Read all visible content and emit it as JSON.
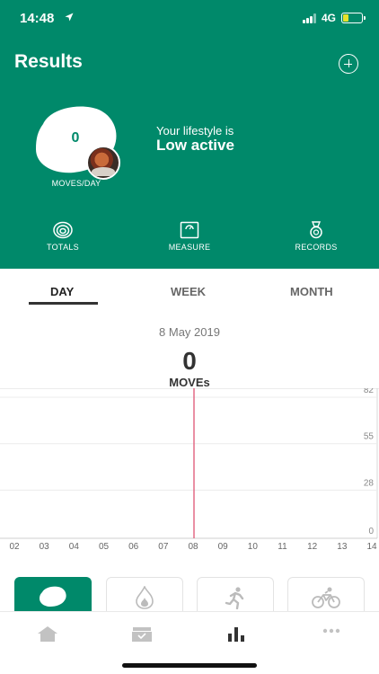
{
  "status_bar": {
    "time": "14:48",
    "network": "4G"
  },
  "header": {
    "title": "Results",
    "add_icon": "plus-circle-icon"
  },
  "summary": {
    "moves_value": "0",
    "moves_label": "MOVES/DAY",
    "lifestyle_label": "Your lifestyle is",
    "lifestyle_value": "Low active"
  },
  "header_nav": [
    {
      "label": "TOTALS",
      "icon": "rings-icon"
    },
    {
      "label": "MEASURE",
      "icon": "scale-icon"
    },
    {
      "label": "RECORDS",
      "icon": "medal-icon"
    }
  ],
  "tabs": {
    "day": "DAY",
    "week": "WEEK",
    "month": "MONTH",
    "active": "DAY"
  },
  "selection": {
    "date": "8 May 2019",
    "value": "0",
    "unit": "MOVEs"
  },
  "chart_data": {
    "type": "bar",
    "x": [
      "02",
      "03",
      "04",
      "05",
      "06",
      "07",
      "08",
      "09",
      "10",
      "11",
      "12",
      "13",
      "14"
    ],
    "values": [
      0,
      0,
      0,
      0,
      0,
      0,
      0,
      0,
      0,
      0,
      0,
      0,
      0
    ],
    "y_ticks": [
      "82",
      "55",
      "28",
      "0"
    ],
    "ylim": [
      0,
      82
    ],
    "grid": true,
    "selected_x": "08",
    "marker_color": "#e0607e"
  },
  "activities": [
    {
      "name": "moves",
      "icon": "moves-blob-icon",
      "active": true
    },
    {
      "name": "calories",
      "icon": "flame-icon",
      "active": false
    },
    {
      "name": "running",
      "icon": "runner-icon",
      "active": false
    },
    {
      "name": "cycling",
      "icon": "bike-icon",
      "active": false
    }
  ],
  "bottom_nav": [
    {
      "name": "home",
      "icon": "home-icon"
    },
    {
      "name": "inbox",
      "icon": "inbox-icon"
    },
    {
      "name": "results",
      "icon": "bar-chart-icon",
      "active": true
    },
    {
      "name": "more",
      "icon": "more-icon"
    }
  ],
  "colors": {
    "brand": "#00896a",
    "marker": "#e0607e"
  }
}
